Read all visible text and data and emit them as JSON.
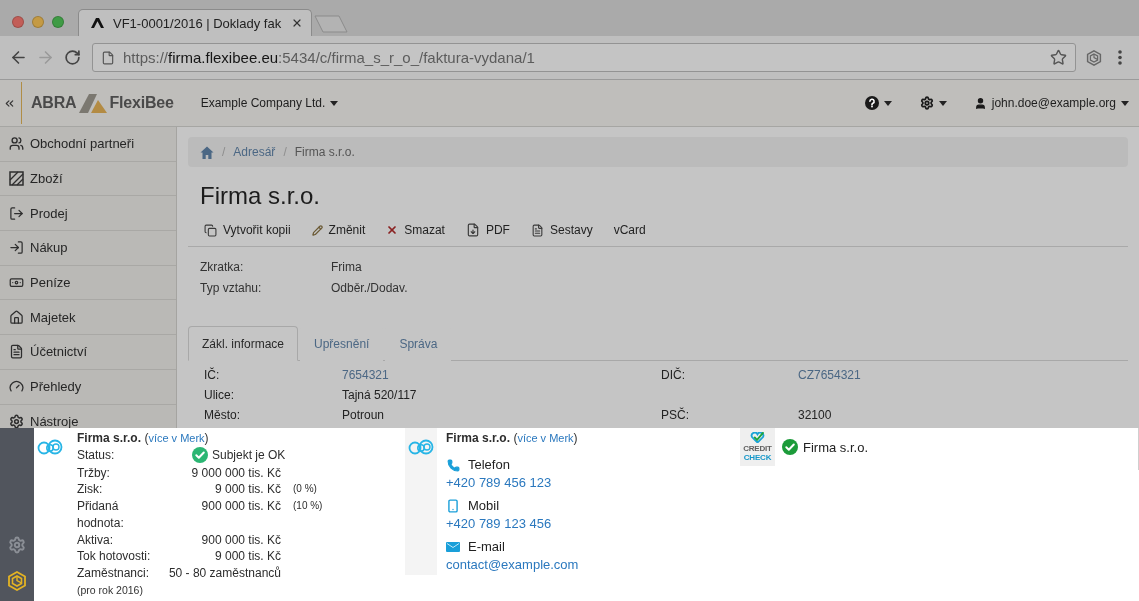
{
  "browser": {
    "tab_title": "VF1-0001/2016 | Doklady fak",
    "url": "https://**firma.flexibee.eu**:5434/c/firma_s_r_o_/faktura-vydana/1"
  },
  "header": {
    "brand": [
      "ABRA",
      "FlexiBee"
    ],
    "company": "Example Company Ltd.",
    "user": "john.doe@example.org"
  },
  "sidebar": {
    "items": [
      {
        "label": "Obchodní partneři"
      },
      {
        "label": "Zboží"
      },
      {
        "label": "Prodej"
      },
      {
        "label": "Nákup"
      },
      {
        "label": "Peníze"
      },
      {
        "label": "Majetek"
      },
      {
        "label": "Účetnictví"
      },
      {
        "label": "Přehledy"
      },
      {
        "label": "Nástroje"
      }
    ]
  },
  "breadcrumb": [
    {
      "kind": "home"
    },
    {
      "kind": "separator",
      "text": "/"
    },
    {
      "kind": "link",
      "text": "Adresář"
    },
    {
      "kind": "separator",
      "text": "/"
    },
    {
      "kind": "current",
      "text": "Firma s.r.o."
    }
  ],
  "title": "Firma s.r.o.",
  "actions": [
    "Vytvořit kopii",
    "Změnit",
    "Smazat",
    "PDF",
    "Sestavy",
    "vCard"
  ],
  "summary": [
    {
      "label": "Zkratka:",
      "value": "Frima"
    },
    {
      "label": "Typ vztahu:",
      "value": "Odběr./Dodav."
    }
  ],
  "tabs": [
    {
      "label": "Zákl. informace",
      "selected": true
    },
    {
      "label": "Upřesnění",
      "selected": false
    },
    {
      "label": "Správa",
      "selected": false
    }
  ],
  "fields": [
    [
      {
        "label": "IČ:",
        "value": "7654321",
        "kind": "link"
      },
      {
        "label": "DIČ:",
        "value": "CZ7654321",
        "kind": "link"
      }
    ],
    [
      {
        "label": "Ulice:",
        "value": "Tajná 520/117",
        "kind": "text"
      }
    ],
    [
      {
        "label": "Město:",
        "value": "Potroun",
        "kind": "text"
      },
      {
        "label": "PSČ:",
        "value": "32100",
        "kind": "text"
      }
    ]
  ],
  "merk_card": {
    "name": "Firma s.r.o.",
    "brackets": [
      "(",
      ")"
    ],
    "link": "více v Merk",
    "rows": [
      {
        "kind": "status",
        "label": "Status:",
        "value": "Subjekt je OK"
      },
      {
        "kind": "amount",
        "label": "Tržby:",
        "value": "9 000 000 tis. Kč"
      },
      {
        "kind": "amount",
        "label": "Zisk:",
        "value": "9 000 tis. Kč",
        "share": "(0 %)"
      },
      {
        "kind": "amount",
        "label": "Přidaná hodnota:",
        "value": "900 000 tis. Kč",
        "share": "(10 %)"
      },
      {
        "kind": "amount",
        "label": "Aktiva:",
        "value": "900 000 tis. Kč"
      },
      {
        "kind": "amount",
        "label": "Tok hotovosti:",
        "value": "9 000 tis. Kč"
      },
      {
        "kind": "amount",
        "label": "Zaměstnanci:",
        "value": "50 - 80 zaměstnanců"
      }
    ],
    "note": "(pro rok 2016)"
  },
  "contact_card": {
    "name": "Firma s.r.o.",
    "brackets": [
      "(",
      ")"
    ],
    "link": "více v Merk",
    "contacts": [
      {
        "kind": "phone",
        "label": "Telefon",
        "value": "+420 789 456 123"
      },
      {
        "kind": "mobile",
        "label": "Mobil",
        "value": "+420 789 123 456"
      },
      {
        "kind": "email",
        "label": "E-mail",
        "value": "contact@example.com"
      }
    ]
  },
  "credit_check": {
    "logo": [
      "CREDIT",
      "CHECK"
    ],
    "name": "Firma s.r.o."
  }
}
